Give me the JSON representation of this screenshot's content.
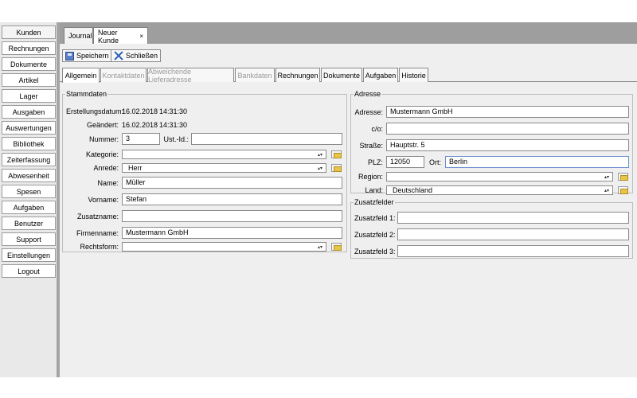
{
  "sidebar": {
    "items": [
      "Kunden",
      "Rechnungen",
      "Dokumente",
      "Artikel",
      "Lager",
      "Ausgaben",
      "Auswertungen",
      "Bibliothek",
      "Zeiterfassung",
      "Abwesenheit",
      "Spesen",
      "Aufgaben",
      "Benutzer",
      "Support",
      "Einstellungen",
      "Logout"
    ],
    "active": "Kunden"
  },
  "doc_tabs": {
    "journal": "Journal",
    "neuer_kunde": "Neuer Kunde",
    "close": "×"
  },
  "toolbar": {
    "save_label": "Speichern",
    "close_label": "Schließen"
  },
  "subtabs": {
    "allgemein": "Allgemein",
    "kontaktdaten": "Kontaktdaten",
    "lieferadresse": "Abweichende Lieferadresse",
    "bankdaten": "Bankdaten",
    "rechnungen": "Rechnungen",
    "dokumente": "Dokumente",
    "aufgaben": "Aufgaben",
    "historie": "Historie"
  },
  "stammdaten": {
    "title": "Stammdaten",
    "erstellungsdatum_label": "Erstellungsdatum:",
    "erstellungsdatum_date": "16.02.2018",
    "erstellungsdatum_time": "14:31:30",
    "geaendert_label": "Geändert:",
    "geaendert_date": "16.02.2018",
    "geaendert_time": "14:31:30",
    "nummer_label": "Nummer:",
    "nummer_value": "3",
    "ustid_label": "Ust.-Id.:",
    "ustid_value": "",
    "kategorie_label": "Kategorie:",
    "kategorie_value": "",
    "anrede_label": "Anrede:",
    "anrede_value": "Herr",
    "name_label": "Name:",
    "name_value": "Müller",
    "vorname_label": "Vorname:",
    "vorname_value": "Stefan",
    "zusatzname_label": "Zusatzname:",
    "zusatzname_value": "",
    "firmenname_label": "Firmenname:",
    "firmenname_value": "Mustermann GmbH",
    "rechtsform_label": "Rechtsform:",
    "rechtsform_value": ""
  },
  "adresse": {
    "title": "Adresse",
    "adresse_label": "Adresse:",
    "adresse_value": "Mustermann GmbH",
    "co_label": "c/o:",
    "co_value": "",
    "strasse_label": "Straße:",
    "strasse_value": "Hauptstr. 5",
    "plz_label": "PLZ:",
    "plz_value": "12050",
    "ort_label": "Ort:",
    "ort_value": "Berlin",
    "region_label": "Region:",
    "region_value": "",
    "land_label": "Land:",
    "land_value": "Deutschland"
  },
  "zusatzfelder": {
    "title": "Zusatzfelder",
    "feld1_label": "Zusatzfeld 1:",
    "feld1_value": "",
    "feld2_label": "Zusatzfeld 2:",
    "feld2_value": "",
    "feld3_label": "Zusatzfeld 3:",
    "feld3_value": ""
  },
  "icons": {
    "save": "save-icon",
    "close": "close-icon",
    "folder": "folder-icon",
    "dropdown": "chevron-updown-icon"
  },
  "colors": {
    "sidebar_bg": "#e9e9e9",
    "tabbar_bg": "#9e9e9e",
    "panel_bg": "#efefef",
    "focus_border": "#6b8fd1"
  }
}
